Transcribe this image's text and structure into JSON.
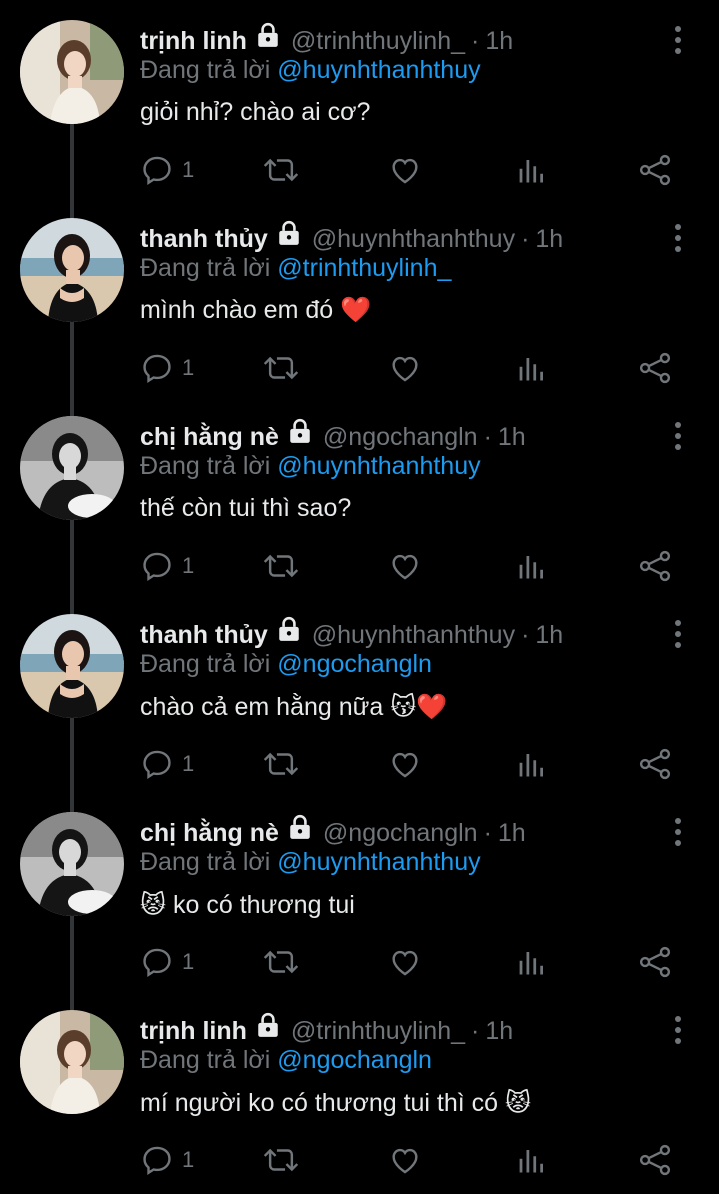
{
  "colors": {
    "background": "#000000",
    "text": "#e7e9ea",
    "muted": "#71767b",
    "link": "#1d9bf0",
    "heart": "#e0243a"
  },
  "icons": [
    "lock-icon",
    "more-vertical-icon",
    "reply-icon",
    "retweet-icon",
    "like-icon",
    "stats-icon",
    "share-icon"
  ],
  "tweets": [
    {
      "name": "trịnh linh",
      "handle": "@trinhthuylinh_",
      "dot": "·",
      "time": "1h",
      "reply_prefix": "Đang trả lời",
      "reply_to": "@huynhthanhthuy",
      "text": "giỏi nhỉ? chào ai cơ?",
      "reply_count": "1"
    },
    {
      "name": "thanh thủy",
      "handle": "@huynhthanhthuy",
      "dot": "·",
      "time": "1h",
      "reply_prefix": "Đang trả lời",
      "reply_to": "@trinhthuylinh_",
      "text": "mình chào em đó ❤️",
      "reply_count": "1"
    },
    {
      "name": "chị hằng nè",
      "handle": "@ngochangln",
      "dot": "·",
      "time": "1h",
      "reply_prefix": "Đang trả lời",
      "reply_to": "@huynhthanhthuy",
      "text": "thế còn tui thì sao?",
      "reply_count": "1"
    },
    {
      "name": "thanh thủy",
      "handle": "@huynhthanhthuy",
      "dot": "·",
      "time": "1h",
      "reply_prefix": "Đang trả lời",
      "reply_to": "@ngochangln",
      "text": "chào cả em hằng nữa 😽❤️",
      "reply_count": "1"
    },
    {
      "name": "chị hằng nè",
      "handle": "@ngochangln",
      "dot": "·",
      "time": "1h",
      "reply_prefix": "Đang trả lời",
      "reply_to": "@huynhthanhthuy",
      "text": "😾 ko có thương tui",
      "reply_count": "1"
    },
    {
      "name": "trịnh linh",
      "handle": "@trinhthuylinh_",
      "dot": "·",
      "time": "1h",
      "reply_prefix": "Đang trả lời",
      "reply_to": "@ngochangln",
      "text": "mí người ko có thương tui thì có 😾",
      "reply_count": "1"
    }
  ]
}
